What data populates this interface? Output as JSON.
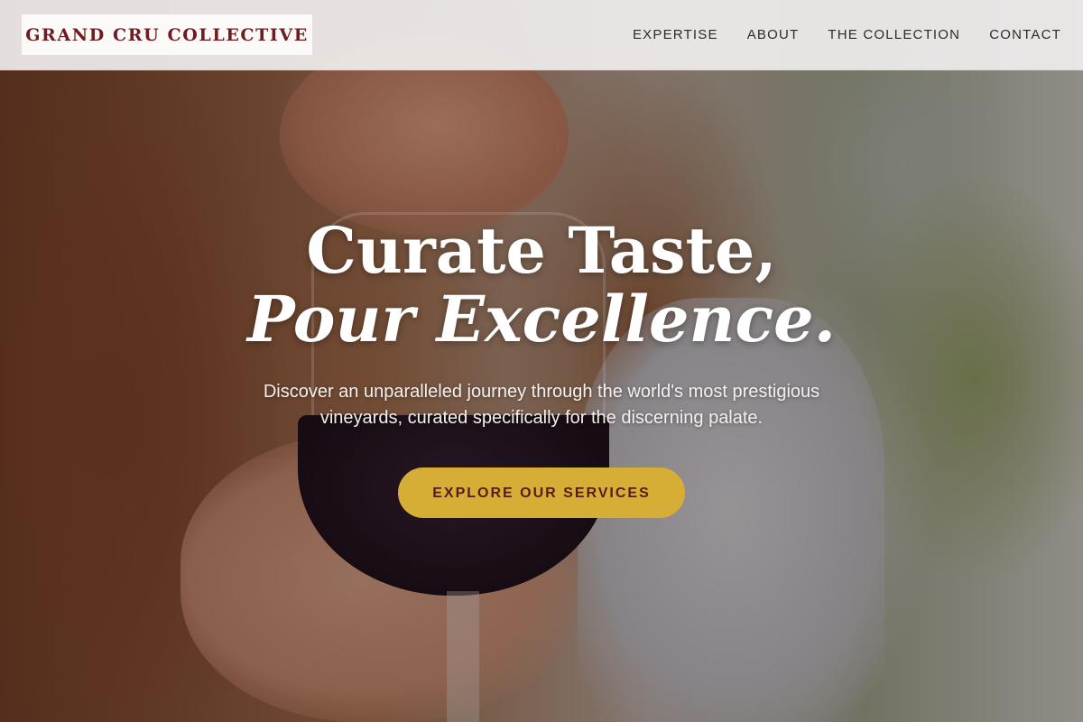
{
  "brand": {
    "name": "GRAND CRU COLLECTIVE"
  },
  "nav": {
    "items": [
      {
        "label": "EXPERTISE"
      },
      {
        "label": "ABOUT"
      },
      {
        "label": "THE COLLECTION"
      },
      {
        "label": "CONTACT"
      }
    ]
  },
  "hero": {
    "title_line1": "Curate Taste,",
    "title_line2": "Pour Excellence.",
    "subtitle": "Discover an unparalleled journey through the world's most prestigious vineyards, curated specifically for the discerning palate.",
    "cta_label": "EXPLORE OUR SERVICES",
    "background_image": "woman-tasting-red-wine-photo"
  },
  "colors": {
    "brand": "#6e1c1f",
    "accent": "#d6ae35",
    "header_bg": "#f0eeee"
  }
}
